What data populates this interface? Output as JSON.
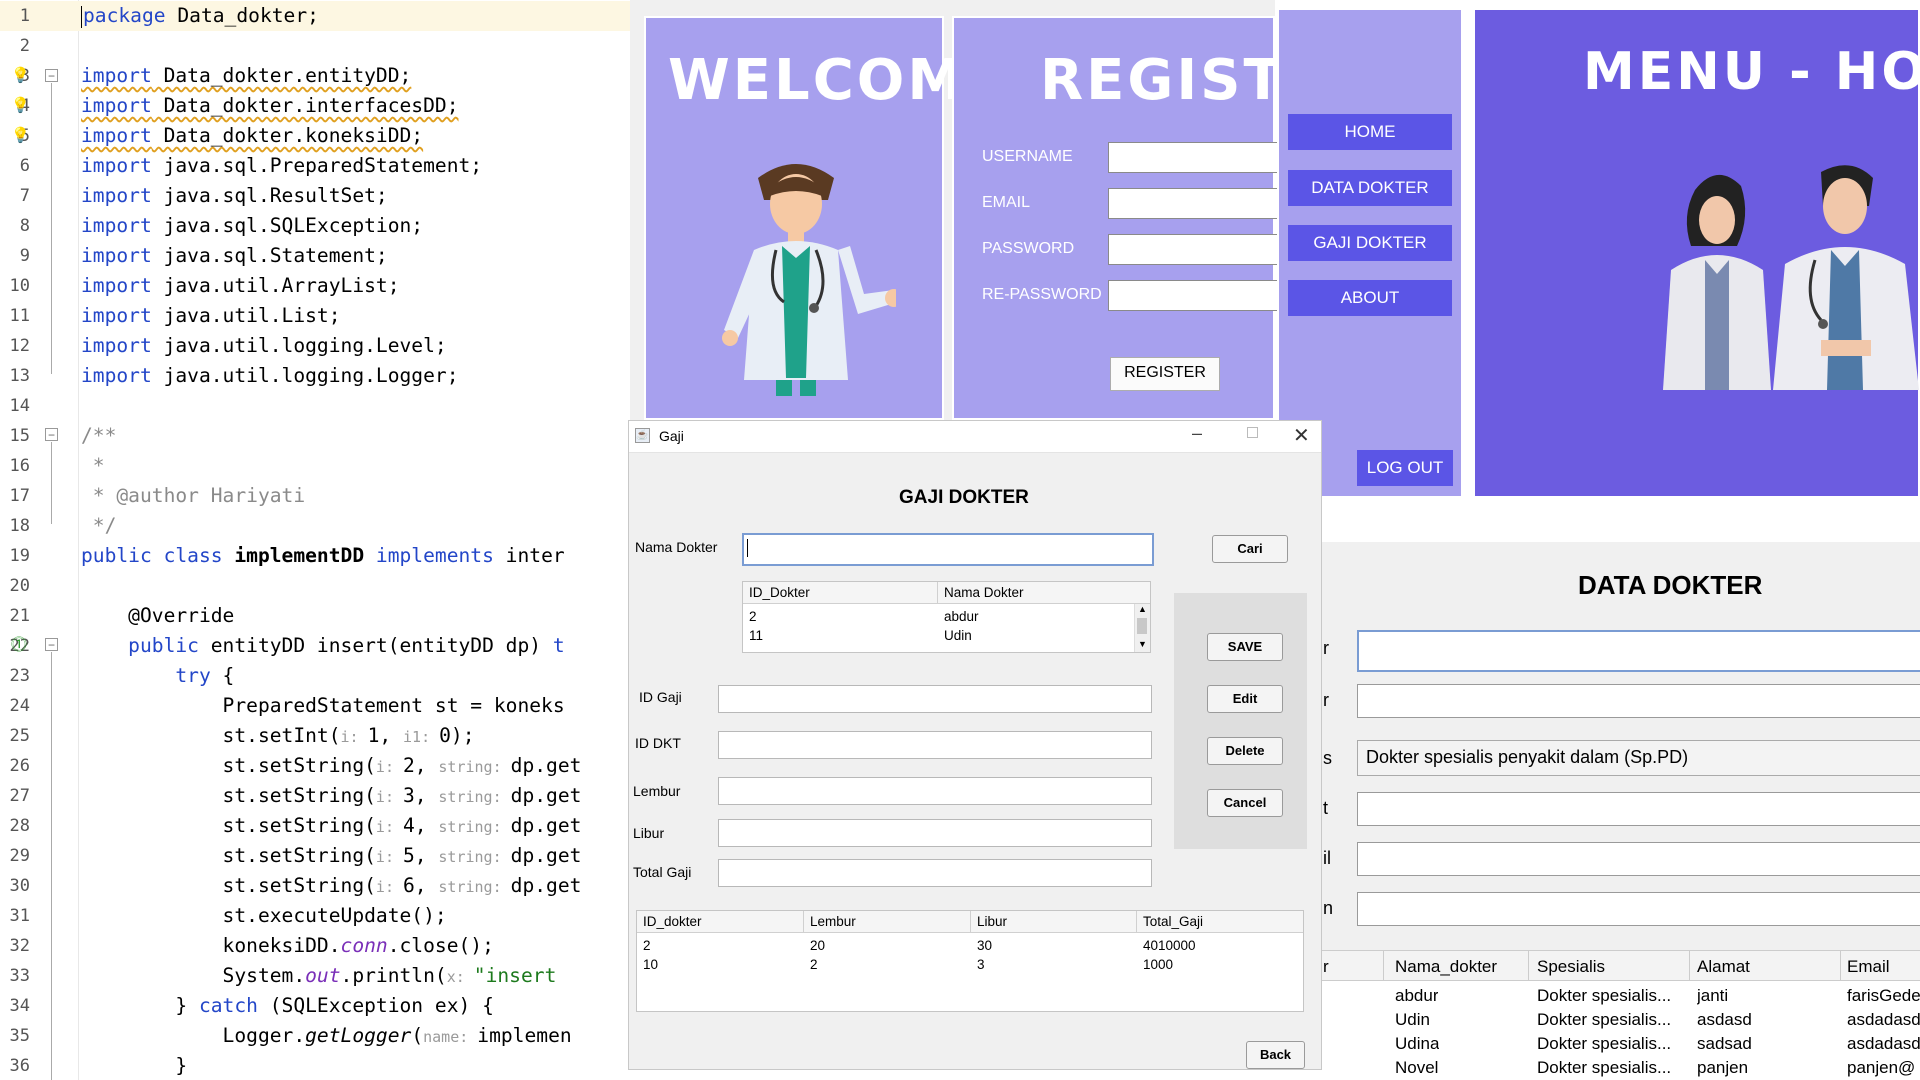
{
  "editor": {
    "lines": [
      {
        "n": "1"
      },
      {
        "n": "2"
      },
      {
        "n": "3"
      },
      {
        "n": "4"
      },
      {
        "n": "5"
      },
      {
        "n": "6"
      },
      {
        "n": "7"
      },
      {
        "n": "8"
      },
      {
        "n": "9"
      },
      {
        "n": "10"
      },
      {
        "n": "11"
      },
      {
        "n": "12"
      },
      {
        "n": "13"
      },
      {
        "n": "14"
      },
      {
        "n": "15"
      },
      {
        "n": "16"
      },
      {
        "n": "17"
      },
      {
        "n": "18"
      },
      {
        "n": "19"
      },
      {
        "n": "20"
      },
      {
        "n": "21"
      },
      {
        "n": "22"
      },
      {
        "n": "23"
      },
      {
        "n": "24"
      },
      {
        "n": "25"
      },
      {
        "n": "26"
      },
      {
        "n": "27"
      },
      {
        "n": "28"
      },
      {
        "n": "29"
      },
      {
        "n": "30"
      },
      {
        "n": "31"
      },
      {
        "n": "32"
      },
      {
        "n": "33"
      },
      {
        "n": "34"
      },
      {
        "n": "35"
      },
      {
        "n": "36"
      }
    ],
    "t": {
      "package_kw": "package",
      "package_name": " Data_dokter;",
      "import": "import",
      "imp3": " Data_dokter.entityDD;",
      "imp4": " Data_dokter.interfacesDD;",
      "imp5": " Data_dokter.koneksiDD;",
      "imp6": " java.sql.PreparedStatement;",
      "imp7": " java.sql.ResultSet;",
      "imp8": " java.sql.SQLException;",
      "imp9": " java.sql.Statement;",
      "imp10": " java.util.ArrayList;",
      "imp11": " java.util.List;",
      "imp12": " java.util.logging.Level;",
      "imp13": " java.util.logging.Logger;",
      "c15": "/**",
      "c16": " *",
      "c17": " * @author Hariyati",
      "c18": " */",
      "l19_public": "public",
      "l19_class": " class",
      "l19_name": " implementDD",
      "l19_impl": " implements",
      "l19_inter": " inter",
      "l21": "    @Override",
      "l22_public": "    public",
      "l22_rest": " entityDD insert(entityDD dp) ",
      "l22_t": "t",
      "l23_try": "        try",
      "l23_brace": " {",
      "l24": "            PreparedStatement st = koneks",
      "l25_a": "            st.setInt(",
      "l25_h1": "i: ",
      "l25_b": "1, ",
      "l25_h2": "i1: ",
      "l25_c": "0);",
      "l26_a": "            st.setString(",
      "l26_h1": "i: ",
      "l26_b": "2, ",
      "l26_h2": "string: ",
      "l26_c": "dp.get",
      "l27_b": "3, ",
      "l28_b": "4, ",
      "l29_b": "5, ",
      "l30_b": "6, ",
      "l31": "            st.executeUpdate();",
      "l32_a": "            koneksiDD.",
      "l32_conn": "conn",
      "l32_b": ".close();",
      "l33_a": "            System.",
      "l33_out": "out",
      "l33_b": ".println(",
      "l33_h": "x: ",
      "l33_str": "\"insert",
      "l34_a": "        } ",
      "l34_catch": "catch",
      "l34_b": " (SQLException ex) {",
      "l35_a": "            Logger.",
      "l35_get": "getLogger",
      "l35_b": "(",
      "l35_h": "name: ",
      "l35_c": "implemen",
      "l36": "        }"
    }
  },
  "welcome": {
    "title": "WELCOME"
  },
  "register": {
    "title": "REGISTER",
    "fields": [
      {
        "label": "USERNAME",
        "value": ""
      },
      {
        "label": "EMAIL",
        "value": ""
      },
      {
        "label": "PASSWORD",
        "value": ""
      },
      {
        "label": "RE-PASSWORD",
        "value": ""
      }
    ],
    "button": "REGISTER"
  },
  "menu": {
    "title": "MENU - HOM",
    "items": [
      "HOME",
      "DATA DOKTER",
      "GAJI DOKTER",
      "ABOUT"
    ],
    "logout": "LOG OUT"
  },
  "data_dokter": {
    "title": "DATA DOKTER",
    "label_fragments": [
      "r",
      "r",
      "s",
      "t",
      "il",
      "n"
    ],
    "spesialis_value": "Dokter spesialis penyakit dalam (Sp.PD)",
    "table": {
      "id_fragment": "r",
      "columns": [
        "Nama_dokter",
        "Spesialis",
        "Alamat",
        "Email"
      ],
      "rows": [
        [
          "abdur",
          "Dokter spesialis...",
          "janti",
          "farisGede"
        ],
        [
          "Udin",
          "Dokter spesialis...",
          "asdasd",
          "asdadasd"
        ],
        [
          "Udina",
          "Dokter spesialis...",
          "sadsad",
          "asdadasd"
        ],
        [
          "Novel",
          "Dokter spesialis...",
          "panjen",
          "panjen@"
        ]
      ]
    }
  },
  "gaji": {
    "window_title": "Gaji",
    "heading": "GAJI DOKTER",
    "nama_label": "Nama Dokter",
    "nama_value": "",
    "cari": "Cari",
    "doctor_table": {
      "columns": [
        "ID_Dokter",
        "Nama Dokter"
      ],
      "rows": [
        [
          "2",
          "abdur"
        ],
        [
          "11",
          "Udin"
        ]
      ]
    },
    "fields": [
      {
        "label": "ID Gaji",
        "value": ""
      },
      {
        "label": "ID DKT",
        "value": ""
      },
      {
        "label": "Lembur",
        "value": ""
      },
      {
        "label": "Libur",
        "value": ""
      },
      {
        "label": "Total Gaji",
        "value": ""
      }
    ],
    "buttons": [
      "SAVE",
      "Edit",
      "Delete",
      "Cancel"
    ],
    "salary_table": {
      "columns": [
        "ID_dokter",
        "Lembur",
        "Libur",
        "Total_Gaji"
      ],
      "rows": [
        [
          "2",
          "20",
          "30",
          "4010000"
        ],
        [
          "10",
          "2",
          "3",
          "1000"
        ]
      ]
    },
    "back": "Back"
  }
}
